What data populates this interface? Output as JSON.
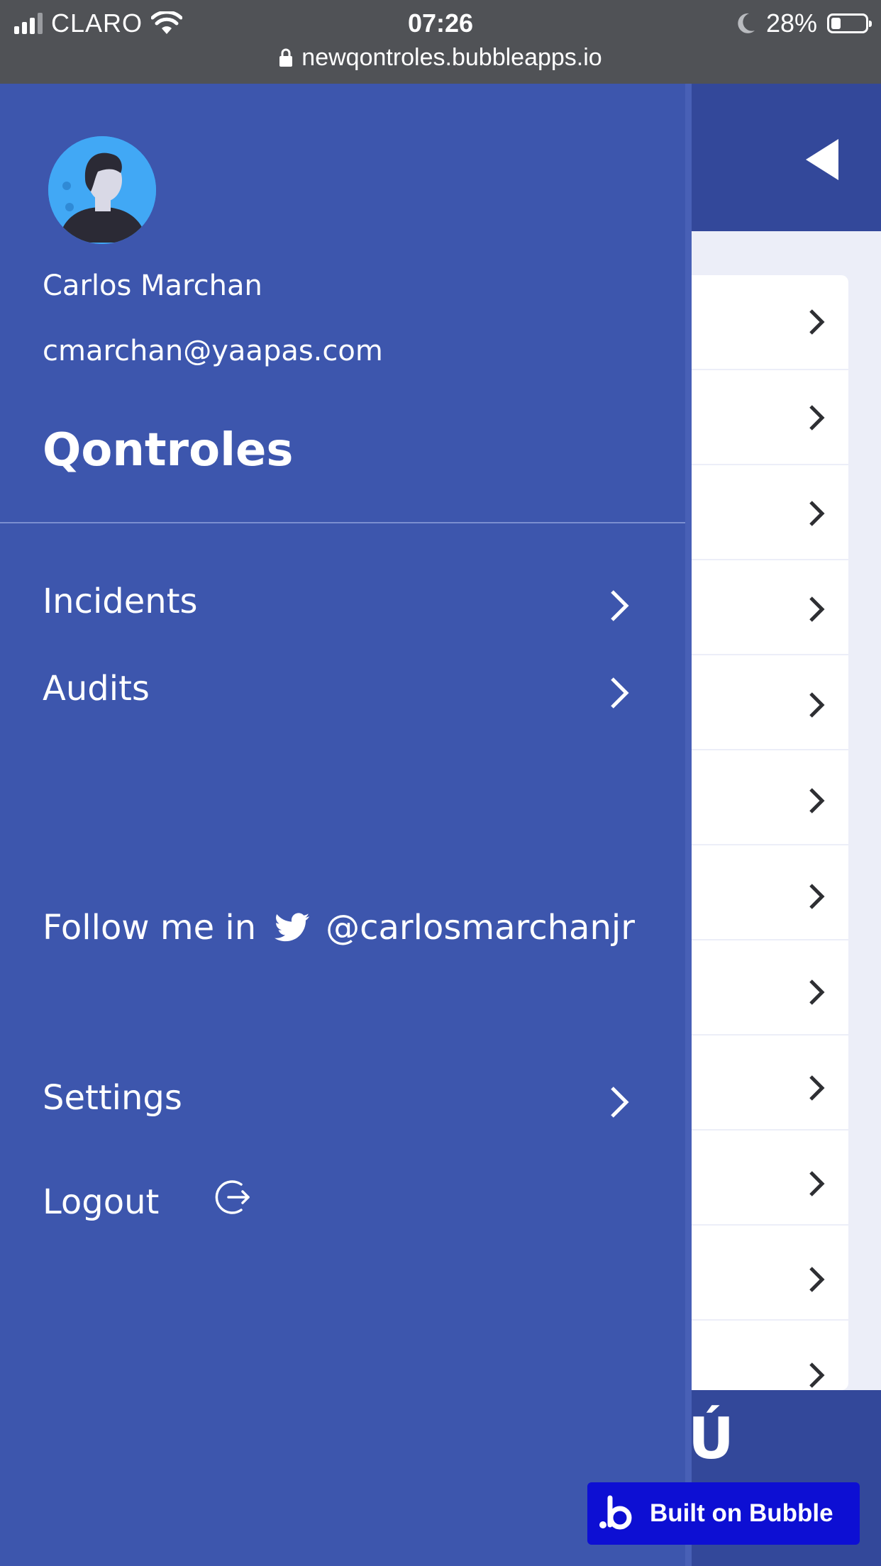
{
  "status_bar": {
    "carrier": "CLARO",
    "time": "07:26",
    "battery_percent": "28%",
    "battery_level": 0.28,
    "url": "newqontroles.bubbleapps.io"
  },
  "drawer": {
    "user_name": "Carlos Marchan",
    "user_email": "cmarchan@yaapas.com",
    "brand": "Qontroles",
    "menu": [
      {
        "label": "Incidents",
        "icon": "chevron-right-icon"
      },
      {
        "label": "Audits",
        "icon": "chevron-right-icon"
      }
    ],
    "follow_text": "Follow me in",
    "follow_handle": "@carlosmarchanjr",
    "settings_label": "Settings",
    "logout_label": "Logout"
  },
  "background_page": {
    "footer_glyph": "Ú"
  },
  "badge": {
    "label": "Built on Bubble"
  },
  "colors": {
    "drawer_bg": "#3d56ad",
    "header_bg": "#33489a",
    "page_bg": "#eceef8",
    "bubble_badge": "#0d0fd3"
  }
}
